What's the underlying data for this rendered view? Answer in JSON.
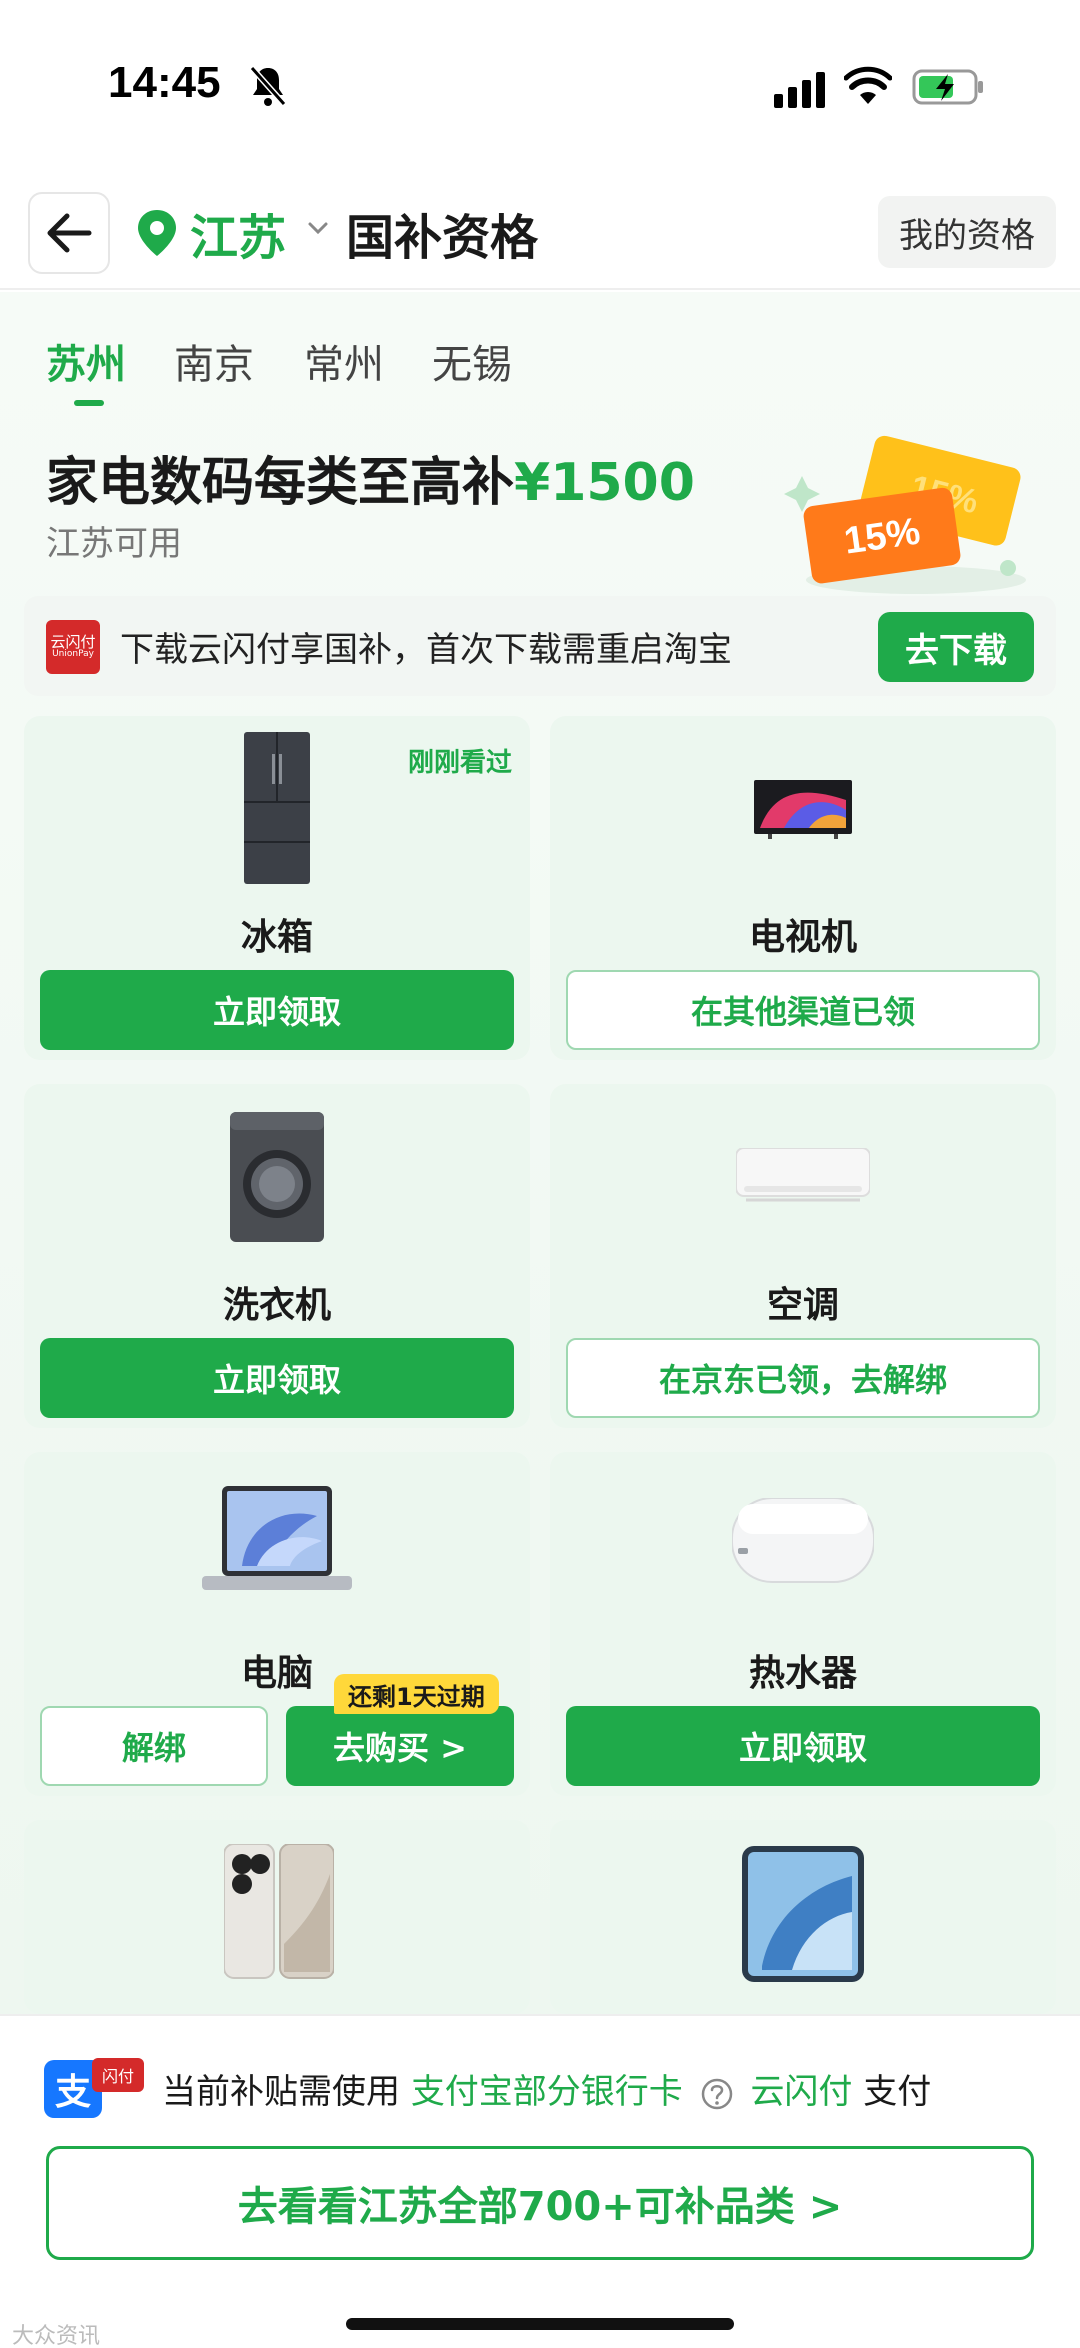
{
  "status_bar": {
    "time": "14:45"
  },
  "nav": {
    "region": "江苏",
    "title": "国补资格",
    "my_qualification": "我的资格"
  },
  "city_tabs": [
    "苏州",
    "南京",
    "常州",
    "无锡"
  ],
  "active_city": "苏州",
  "headline": {
    "prefix": "家电数码每类至高补",
    "amount": "¥1500",
    "sub": "江苏可用"
  },
  "coupon_art": {
    "percent_front": "15%",
    "percent_back": "15%"
  },
  "download_banner": {
    "logo_line1": "云闪付",
    "logo_line2": "UnionPay",
    "text": "下载云闪付享国补，首次下载需重启淘宝",
    "button": "去下载"
  },
  "cards": [
    {
      "name": "冰箱",
      "badge": "刚刚看过",
      "button": "立即领取",
      "style": "solid",
      "icon": "fridge-icon"
    },
    {
      "name": "电视机",
      "button": "在其他渠道已领",
      "style": "outline",
      "icon": "tv-icon"
    },
    {
      "name": "洗衣机",
      "button": "立即领取",
      "style": "solid",
      "icon": "washer-icon"
    },
    {
      "name": "空调",
      "button": "在京东已领，去解绑",
      "style": "outline",
      "icon": "ac-icon"
    },
    {
      "name": "电脑",
      "buttons": [
        "解绑",
        "去购买 >"
      ],
      "expire_badge": "还剩1天过期",
      "icon": "laptop-icon"
    },
    {
      "name": "热水器",
      "button": "立即领取",
      "style": "solid",
      "icon": "water-heater-icon"
    },
    {
      "name": "手机",
      "icon": "phone-icon"
    },
    {
      "name": "平板",
      "icon": "tablet-icon"
    }
  ],
  "bottom": {
    "alipay_char": "支",
    "unionpay_mini": "闪付",
    "pay_prefix": "当前补贴需使用",
    "pay_alipay": "支付宝部分银行卡",
    "pay_unionpay": "云闪付",
    "pay_suffix": "支付",
    "see_all": "去看看江苏全部700+可补品类 >"
  },
  "watermark": "大众资讯",
  "colors": {
    "brand_green": "#1faa4a",
    "badge_yellow": "#ffd83a",
    "coupon_orange": "#ff7a1a"
  }
}
